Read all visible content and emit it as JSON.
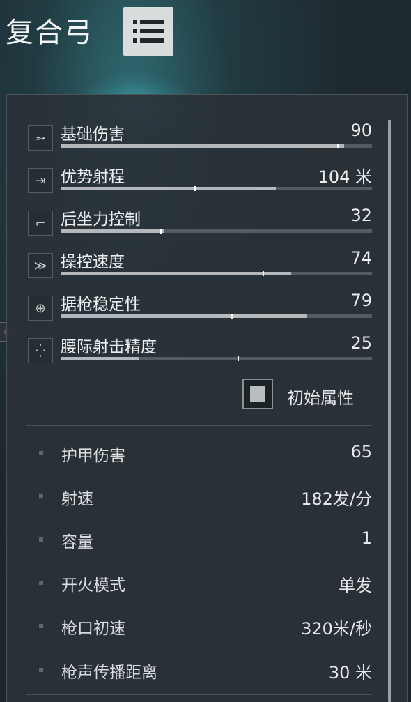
{
  "header": {
    "weapon_name": "复合弓",
    "menu_icon": "list-icon"
  },
  "colors": {
    "bar_fill": "#b4b8ba",
    "bar_track": "#545c61",
    "marker": "#ffffff"
  },
  "stats": [
    {
      "icon": "damage-icon",
      "glyph": "➵",
      "label": "基础伤害",
      "value": "90",
      "fill": 0.91,
      "marker": 0.89
    },
    {
      "icon": "range-icon",
      "glyph": "⇥",
      "label": "优势射程",
      "value": "104 米",
      "fill": 0.69,
      "marker": 0.43
    },
    {
      "icon": "recoil-icon",
      "glyph": "⌐",
      "label": "后坐力控制",
      "value": "32",
      "fill": 0.33,
      "marker": 0.32
    },
    {
      "icon": "handling-icon",
      "glyph": "≫",
      "label": "操控速度",
      "value": "74",
      "fill": 0.74,
      "marker": 0.65
    },
    {
      "icon": "crosshair-icon",
      "glyph": "⊕",
      "label": "据枪稳定性",
      "value": "79",
      "fill": 0.79,
      "marker": 0.55
    },
    {
      "icon": "hipfire-icon",
      "glyph": "⁛",
      "label": "腰际射击精度",
      "value": "25",
      "fill": 0.25,
      "marker": 0.57
    }
  ],
  "base_toggle": {
    "label": "初始属性",
    "checked": true
  },
  "attributes": [
    {
      "label": "护甲伤害",
      "value": "65"
    },
    {
      "label": "射速",
      "value": "182发/分"
    },
    {
      "label": "容量",
      "value": "1"
    },
    {
      "label": "开火模式",
      "value": "单发"
    },
    {
      "label": "枪口初速",
      "value": "320米/秒"
    },
    {
      "label": "枪声传播距离",
      "value": "30 米"
    }
  ],
  "side_icon": "link-icon"
}
